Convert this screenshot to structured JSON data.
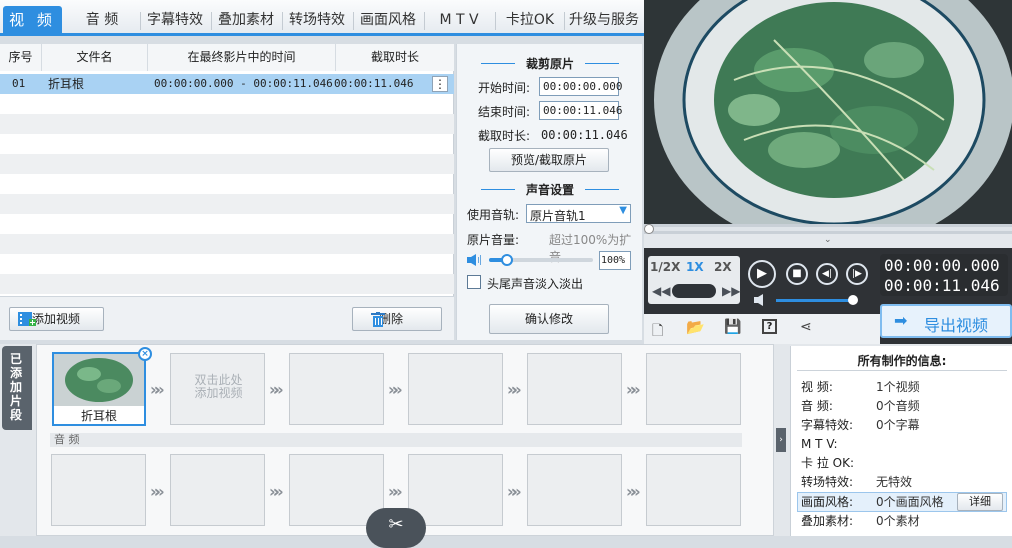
{
  "tabs": [
    {
      "label": "视 频",
      "active": true
    },
    {
      "label": "音 频"
    },
    {
      "label": "字幕特效"
    },
    {
      "label": "叠加素材"
    },
    {
      "label": "转场特效"
    },
    {
      "label": "画面风格"
    },
    {
      "label": "M T V"
    },
    {
      "label": "卡拉OK"
    },
    {
      "label": "升级与服务"
    }
  ],
  "list": {
    "headers": [
      "序号",
      "文件名",
      "在最终影片中的时间",
      "截取时长"
    ],
    "rows": [
      {
        "idx": "01",
        "name": "折耳根",
        "time": "00:00:00.000 - 00:00:11.046",
        "dur": "00:00:11.046"
      }
    ],
    "more_icon": "⋮"
  },
  "clip": {
    "title": "裁剪原片",
    "start_label": "开始时间:",
    "start_value": "00:00:00.000",
    "end_label": "结束时间:",
    "end_value": "00:00:11.046",
    "dur_label": "截取时长:",
    "dur_value": "00:00:11.046",
    "preview_btn": "预览/截取原片"
  },
  "sound": {
    "title": "声音设置",
    "track_label": "使用音轨:",
    "track_value": "原片音轨1",
    "vol_label": "原片音量:",
    "vol_hint": "超过100%为扩音",
    "vol_value": "100%",
    "fade_label": "头尾声音淡入淡出",
    "confirm_btn": "确认修改"
  },
  "actions": {
    "add_video": "添加视频",
    "delete": "删除"
  },
  "player": {
    "speeds": [
      "1/2X",
      "1X",
      "2X"
    ],
    "current_time": "00:00:00.000",
    "total_time": "00:00:11.046",
    "export_btn": "导出视频"
  },
  "timeline": {
    "side_label": "已添加片段",
    "clip_name": "折耳根",
    "placeholder": "双击此处\n添加视频",
    "audio_label": "音 频"
  },
  "info": {
    "title": "所有制作的信息:",
    "rows": [
      {
        "k": "视 频:",
        "v": "1个视频"
      },
      {
        "k": "音 频:",
        "v": "0个音频"
      },
      {
        "k": "字幕特效:",
        "v": "0个字幕"
      },
      {
        "k": "M T V:",
        "v": ""
      },
      {
        "k": "卡 拉 OK:",
        "v": ""
      },
      {
        "k": "转场特效:",
        "v": "无特效"
      },
      {
        "k": "画面风格:",
        "v": "0个画面风格"
      },
      {
        "k": "叠加素材:",
        "v": "0个素材"
      }
    ],
    "detail_btn": "详细"
  },
  "colors": {
    "accent": "#2e8ee0",
    "player_bg": "#2f3236"
  }
}
